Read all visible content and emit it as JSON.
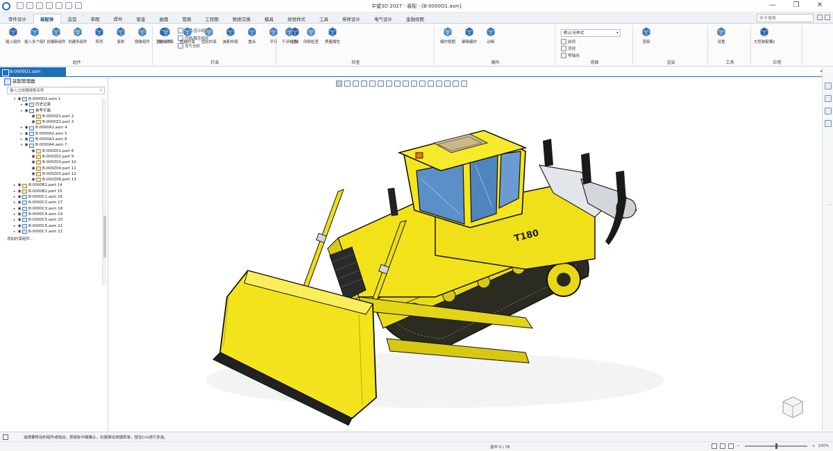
{
  "window": {
    "title": "中望3D 2027 - 装配 - [B-0000O1.asm]",
    "qat_icons": [
      "new-icon",
      "open-icon",
      "save-icon",
      "undo-icon",
      "redo-icon",
      "print-icon",
      "select-filter-icon"
    ],
    "controls": [
      "—",
      "❐",
      "✕"
    ]
  },
  "tabs": [
    "零件设计",
    "装配体",
    "造型",
    "草图",
    "焊件",
    "钣金",
    "曲面",
    "管路",
    "工程图",
    "数据交换",
    "模具",
    "视觉样式",
    "工具",
    "排样设计",
    "电气设计",
    "金融视图"
  ],
  "active_tab": 1,
  "command_search": {
    "placeholder": "命令搜索"
  },
  "ribbon": {
    "groups": [
      {
        "label": "组件",
        "buttons": [
          "插入组件",
          "插入多个组件",
          "创建新组件",
          "创建多组件",
          "阵列",
          "复制",
          "镜像组件",
          "替换组件"
        ],
        "small": [
          "隐藏/显示组件",
          "压缩/解压组件",
          "设为当前"
        ]
      },
      {
        "label": "约束",
        "buttons": [
          "插入约束",
          "机械约束",
          "齿轮约束",
          "装配布局",
          "重合",
          "平行",
          "同轴"
        ]
      },
      {
        "label": "检查",
        "buttons": [
          "干涉检查",
          "间隙检查",
          "质量属性"
        ]
      },
      {
        "label": "爆炸",
        "buttons": [
          "爆炸视图",
          "编辑爆炸",
          "动画"
        ]
      },
      {
        "label": "视图",
        "combo": "默认/无样式",
        "small": [
          "前视",
          "顶视",
          "等轴测"
        ]
      },
      {
        "label": "渲染",
        "buttons": [
          "渲染"
        ]
      },
      {
        "label": "工具",
        "buttons": [
          "设置"
        ]
      },
      {
        "label": "应用",
        "buttons": [
          "大型装配模式"
        ]
      }
    ]
  },
  "doc_tab": {
    "label": "B-0000O1.asm"
  },
  "panel": {
    "title": "装配管理器",
    "filter_placeholder": "输入过滤器搜索名称",
    "tree": [
      {
        "label": "B-0000O1.asm 1",
        "indent": 0,
        "type": "asm",
        "expand": "▾"
      },
      {
        "label": "历史记录",
        "indent": 1,
        "type": "asm",
        "expand": "▸"
      },
      {
        "label": "参考平面",
        "indent": 1,
        "type": "asm",
        "expand": "▸"
      },
      {
        "label": "B-0000Z1.part 2",
        "indent": 2,
        "type": "part",
        "expand": ""
      },
      {
        "label": "B-0000Z2.part 3",
        "indent": 2,
        "type": "part",
        "expand": ""
      },
      {
        "label": "B-0000A1.asm 4",
        "indent": 1,
        "type": "asm",
        "expand": "▸"
      },
      {
        "label": "B-0000A2.asm 5",
        "indent": 1,
        "type": "asm",
        "expand": "▸"
      },
      {
        "label": "B-0000A3.asm 6",
        "indent": 1,
        "type": "asm",
        "expand": "▸"
      },
      {
        "label": "B-0000A4.asm 7",
        "indent": 1,
        "type": "asm",
        "expand": "▾"
      },
      {
        "label": "B-000Z01.part 8",
        "indent": 2,
        "type": "part",
        "expand": ""
      },
      {
        "label": "B-000Z02.part 9",
        "indent": 2,
        "type": "part",
        "expand": ""
      },
      {
        "label": "B-000Z03.part 10",
        "indent": 2,
        "type": "part",
        "expand": ""
      },
      {
        "label": "B-000Z04.part 11",
        "indent": 2,
        "type": "part",
        "expand": ""
      },
      {
        "label": "B-000Z05.part 12",
        "indent": 2,
        "type": "part",
        "expand": ""
      },
      {
        "label": "B-000Z06.part 13",
        "indent": 2,
        "type": "part",
        "expand": ""
      },
      {
        "label": "B-0000B1.part 14",
        "indent": 0,
        "type": "part",
        "expand": "▸"
      },
      {
        "label": "B-0000B2.part 15",
        "indent": 0,
        "type": "part",
        "expand": "▸"
      },
      {
        "label": "B-0000C1.asm 16",
        "indent": 0,
        "type": "asm",
        "expand": "▸"
      },
      {
        "label": "B-0000C2.asm 17",
        "indent": 0,
        "type": "asm",
        "expand": "▸"
      },
      {
        "label": "B-0000C3.asm 18",
        "indent": 0,
        "type": "asm",
        "expand": "▸"
      },
      {
        "label": "B-0000C4.asm 19",
        "indent": 0,
        "type": "asm",
        "expand": "▸"
      },
      {
        "label": "B-0000C5.asm 20",
        "indent": 0,
        "type": "asm",
        "expand": "▸"
      },
      {
        "label": "B-0000C6.asm 21",
        "indent": 0,
        "type": "asm",
        "expand": "▸"
      },
      {
        "label": "B-0000C7.asm 22",
        "indent": 0,
        "type": "asm",
        "expand": "▸"
      }
    ],
    "end_label": "添加约束组件..."
  },
  "viewbar_icons": [
    "select-icon",
    "view-cube-icon",
    "fit-icon",
    "zoom-icon",
    "pan-icon",
    "rotate-icon",
    "section-icon",
    "render-mode-icon",
    "light-icon",
    "visibility-icon",
    "measure-icon",
    "color-icon",
    "display-icon",
    "filter-icon",
    "snap-icon",
    "grid-icon"
  ],
  "model": {
    "text": "T180"
  },
  "statusbar": {
    "message": "选择要移动的组件或拖动，按鼠标中键确认，右键弹出快捷菜单，按住Ctrl进行多选。",
    "selection": "选中 0 / 78",
    "zoom": "100%"
  },
  "colors": {
    "accent": "#1f6fb8",
    "model_yellow": "#f2e21a",
    "model_dark": "#2a2a1a",
    "glass": "#5b8fc8"
  }
}
